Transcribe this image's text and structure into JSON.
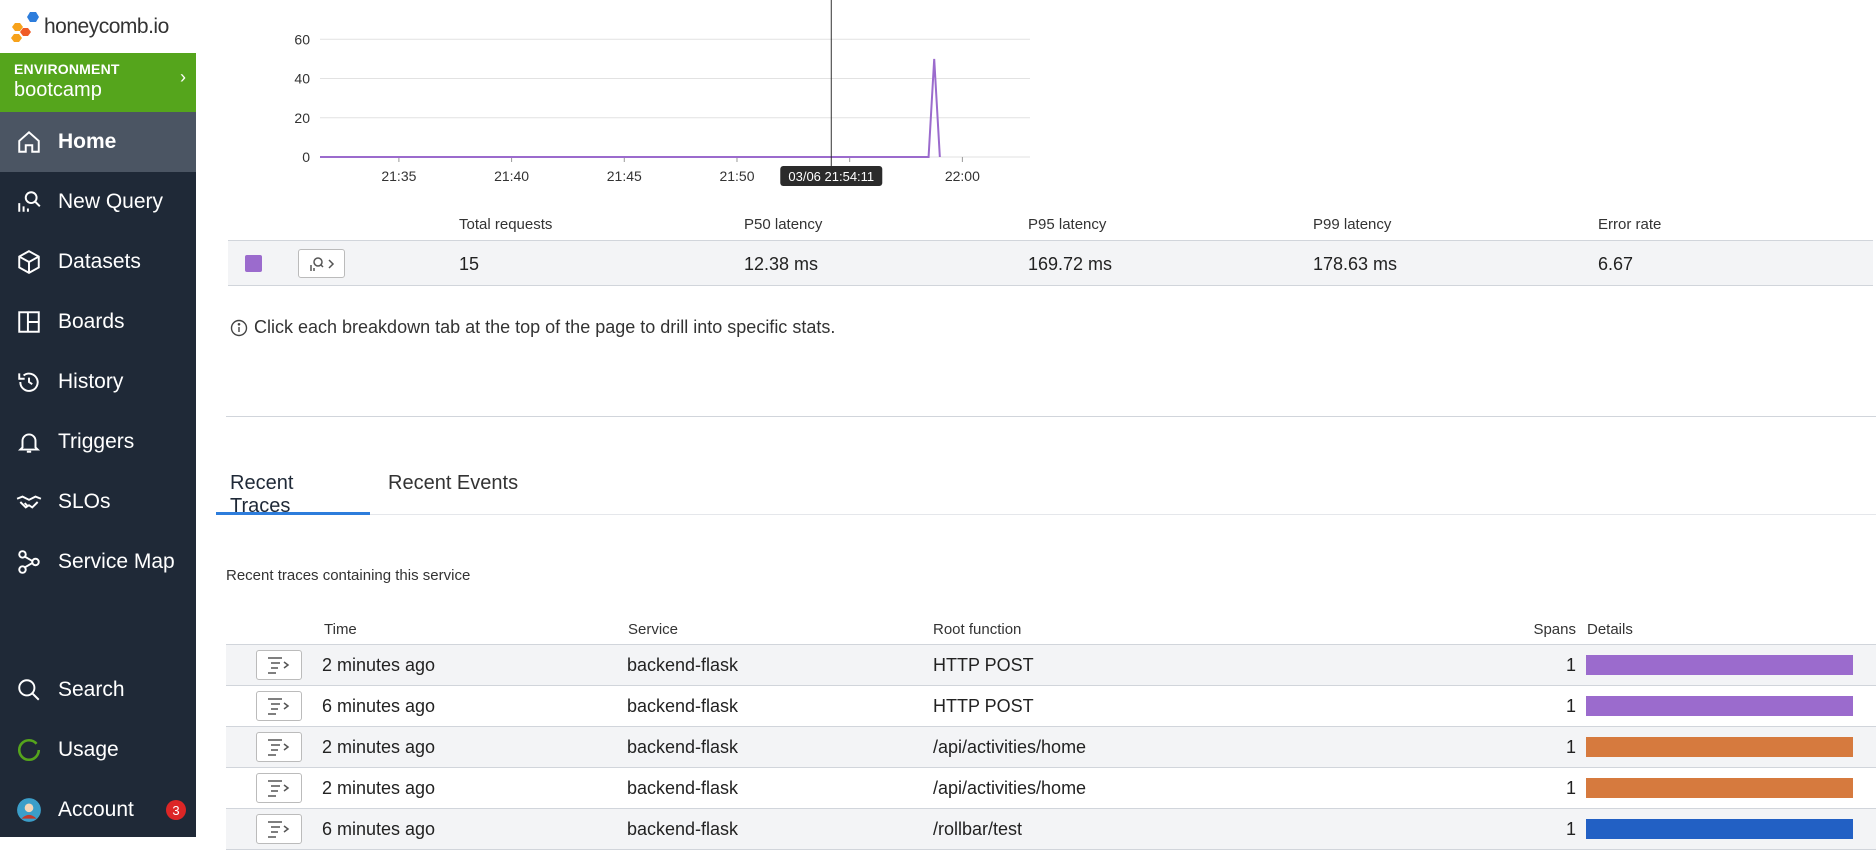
{
  "app": {
    "logo_text": "honeycomb.io"
  },
  "environment": {
    "label": "ENVIRONMENT",
    "name": "bootcamp"
  },
  "nav": [
    {
      "label": "Home",
      "icon": "home-icon",
      "active": true
    },
    {
      "label": "New Query",
      "icon": "query-icon"
    },
    {
      "label": "Datasets",
      "icon": "dataset-icon"
    },
    {
      "label": "Boards",
      "icon": "boards-icon"
    },
    {
      "label": "History",
      "icon": "history-icon"
    },
    {
      "label": "Triggers",
      "icon": "bell-icon"
    },
    {
      "label": "SLOs",
      "icon": "handshake-icon"
    },
    {
      "label": "Service Map",
      "icon": "service-map-icon"
    }
  ],
  "nav_bottom": [
    {
      "label": "Search",
      "icon": "search-icon"
    },
    {
      "label": "Usage",
      "icon": "usage-icon"
    },
    {
      "label": "Account",
      "icon": "avatar",
      "badge": "3"
    }
  ],
  "chart_data": {
    "type": "line",
    "x_ticks": [
      "21:35",
      "21:40",
      "21:45",
      "21:50",
      "21:55",
      "22:00"
    ],
    "yticks": [
      0,
      20,
      40,
      60
    ],
    "ylim": [
      0,
      80
    ],
    "xlim": [
      "21:31:30",
      "22:03"
    ],
    "series": [
      {
        "color": "#9b6bcd",
        "points": [
          [
            "21:31:30",
            0
          ],
          [
            "21:58:30",
            0
          ],
          [
            "21:58:45",
            50
          ],
          [
            "21:59:00",
            0
          ]
        ]
      }
    ],
    "cursor": {
      "time": "21:54:11",
      "label": "03/06 21:54:11"
    }
  },
  "stats": {
    "headers": [
      "Total requests",
      "P50 latency",
      "P95 latency",
      "P99 latency",
      "Error rate"
    ],
    "row": {
      "swatch_color": "#9b6bcd",
      "values": [
        "15",
        "12.38 ms",
        "169.72 ms",
        "178.63 ms",
        "6.67"
      ]
    }
  },
  "info_text": "Click each breakdown tab at the top of the page to drill into specific stats.",
  "tabs": [
    {
      "label": "Recent Traces",
      "active": true
    },
    {
      "label": "Recent Events"
    }
  ],
  "traces": {
    "caption": "Recent traces containing this service",
    "headers": {
      "time": "Time",
      "service": "Service",
      "root": "Root function",
      "spans": "Spans",
      "details": "Details"
    },
    "rows": [
      {
        "time": "2 minutes ago",
        "service": "backend-flask",
        "root": "HTTP POST",
        "spans": "1",
        "color": "#9b6bcd"
      },
      {
        "time": "6 minutes ago",
        "service": "backend-flask",
        "root": "HTTP POST",
        "spans": "1",
        "color": "#9b6bcd"
      },
      {
        "time": "2 minutes ago",
        "service": "backend-flask",
        "root": "/api/activities/home",
        "spans": "1",
        "color": "#d67a3e"
      },
      {
        "time": "2 minutes ago",
        "service": "backend-flask",
        "root": "/api/activities/home",
        "spans": "1",
        "color": "#d67a3e"
      },
      {
        "time": "6 minutes ago",
        "service": "backend-flask",
        "root": "/rollbar/test",
        "spans": "1",
        "color": "#2260c4"
      }
    ]
  }
}
